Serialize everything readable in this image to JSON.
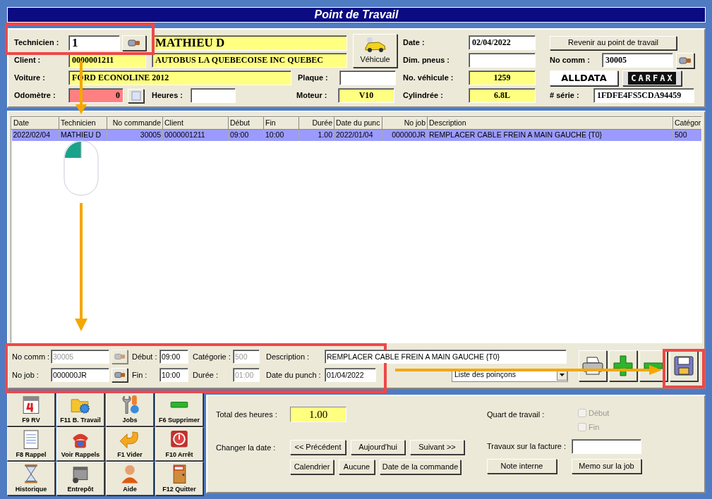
{
  "window": {
    "title": "Point de Travail"
  },
  "header": {
    "technician_label": "Technicien :",
    "technician": "1",
    "technician_name": "MATHIEU D",
    "client_label": "Client :",
    "client_code": "0000001211",
    "client_name": "AUTOBUS LA QUEBECOISE INC QUEBEC",
    "vehicle_button": "Véhicule",
    "car_label": "Voiture :",
    "car": "FORD ECONOLINE 2012",
    "plate_label": "Plaque :",
    "odometer_label": "Odomètre :",
    "odometer": "0",
    "hours_label": "Heures :",
    "engine_label": "Moteur :",
    "engine": "V10",
    "date_label": "Date :",
    "date": "02/04/2022",
    "tire_label": "Dim. pneus :",
    "vehicle_no_label": "No. véhicule :",
    "vehicle_no": "1259",
    "cylinder_label": "Cylindrée :",
    "cylinder": "6.8L",
    "return_button": "Revenir au point de travail",
    "order_label": "No comm :",
    "order": "30005",
    "alldata": "ALLDATA",
    "carfax": "CARFAX",
    "serial_label": "# série :",
    "serial": "1FDFE4FS5CDA94459"
  },
  "table": {
    "columns": [
      "Date",
      "Technicien",
      "No commande",
      "Client",
      "Début",
      "Fin",
      "Durée",
      "Date du punc",
      "No job",
      "Description",
      "Catégor"
    ],
    "rows": [
      {
        "selected": true,
        "cells": [
          "2022/02/04",
          "MATHIEU D",
          "30005",
          "0000001211",
          "09:00",
          "10:00",
          "1.00",
          "2022/01/04",
          "000000JR",
          "REMPLACER CABLE FREIN A MAIN GAUCHE {T0}",
          "500"
        ]
      }
    ]
  },
  "detail": {
    "order_label": "No comm :",
    "order": "30005",
    "order_disabled": true,
    "job_label": "No job :",
    "job": "000000JR",
    "start_label": "Début :",
    "start": "09:00",
    "end_label": "Fin :",
    "end": "10:00",
    "category_label": "Catégorie :",
    "category": "500",
    "category_disabled": true,
    "duration_label": "Durée :",
    "duration": "01:00",
    "duration_disabled": true,
    "description_label": "Description :",
    "description": "REMPLACER CABLE FREIN A MAIN GAUCHE {T0}",
    "punch_date_label": "Date du punch :",
    "punch_date": "01/04/2022",
    "punch_list": "Liste des poinçons"
  },
  "fkeys": [
    {
      "label": "F9 RV"
    },
    {
      "label": "F11 B. Travail"
    },
    {
      "label": "Jobs"
    },
    {
      "label": "F6 Supprimer"
    },
    {
      "label": "F8 Rappel"
    },
    {
      "label": "Voir Rappels"
    },
    {
      "label": "F1 Vider"
    },
    {
      "label": "F10 Arrêt"
    },
    {
      "label": "Historique"
    },
    {
      "label": "Entrepôt"
    },
    {
      "label": "Aide"
    },
    {
      "label": "F12 Quitter"
    }
  ],
  "summary": {
    "total_label": "Total des heures  :",
    "total": "1.00",
    "shift_label": "Quart de travail :",
    "shift_options": [
      {
        "label": "Début",
        "checked": false,
        "disabled": true
      },
      {
        "label": "Fin",
        "checked": false,
        "disabled": true
      }
    ],
    "change_date_label": "Changer la date :",
    "date_buttons": [
      "<< Précédent",
      "Aujourd'hui",
      "Suivant >>",
      "Calendrier",
      "Aucune",
      "Date de la commande"
    ],
    "invoice_label": "Travaux sur la facture :",
    "note_buttons": [
      "Note interne",
      "Memo sur la job"
    ]
  }
}
